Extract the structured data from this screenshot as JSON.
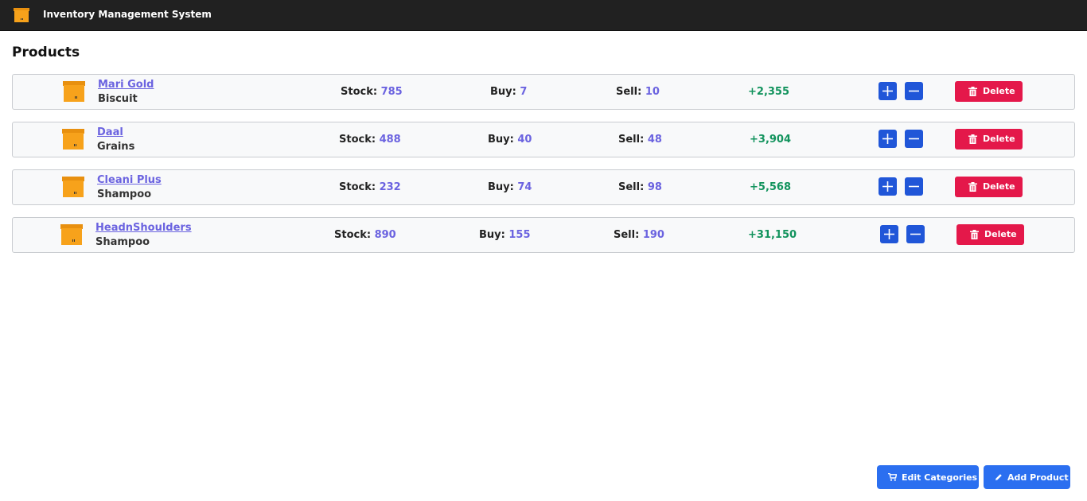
{
  "app": {
    "title": "Inventory Management System",
    "icon": "box-icon"
  },
  "page_title": "Products",
  "labels": {
    "stock": "Stock:",
    "buy": "Buy:",
    "sell": "Sell:",
    "delete": "Delete"
  },
  "products": [
    {
      "name": "Mari Gold",
      "category": "Biscuit",
      "stock": "785",
      "buy": "7",
      "sell": "10",
      "profit": "+2,355"
    },
    {
      "name": "Daal",
      "category": "Grains",
      "stock": "488",
      "buy": "40",
      "sell": "48",
      "profit": "+3,904"
    },
    {
      "name": "Cleani Plus",
      "category": "Shampoo",
      "stock": "232",
      "buy": "74",
      "sell": "98",
      "profit": "+5,568"
    },
    {
      "name": "HeadnShoulders",
      "category": "Shampoo",
      "stock": "890",
      "buy": "155",
      "sell": "190",
      "profit": "+31,150"
    }
  ],
  "footer": {
    "edit_categories": "Edit Categories",
    "add_product": "Add Product"
  },
  "colors": {
    "topbar": "#212121",
    "link": "#6b63e0",
    "profit": "#12935d",
    "qty_button": "#2056d8",
    "delete_button": "#e4184a",
    "action_button": "#2b6ff0",
    "box_icon": "#f7a21b"
  }
}
